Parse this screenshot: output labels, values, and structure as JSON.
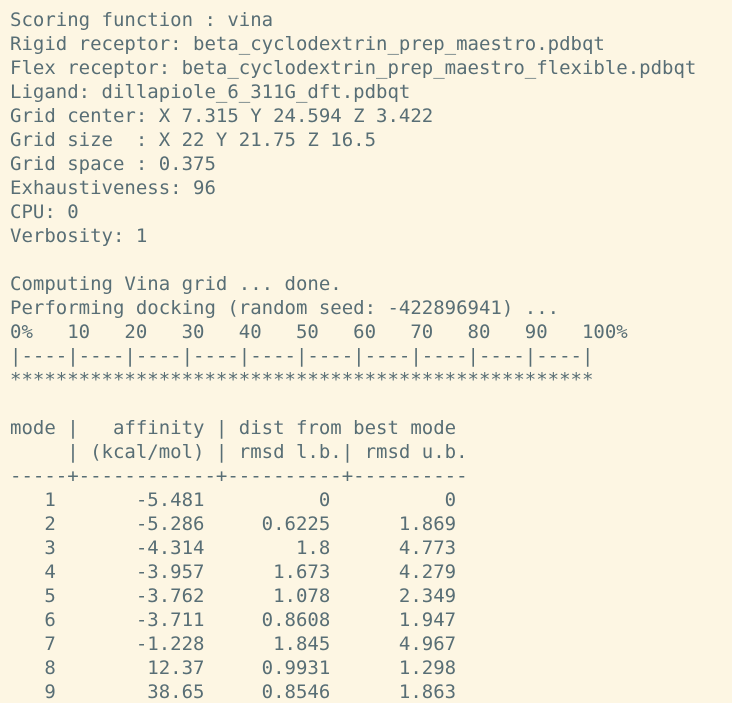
{
  "terminal": {
    "header": [
      "Scoring function : vina",
      "Rigid receptor: beta_cyclodextrin_prep_maestro.pdbqt",
      "Flex receptor: beta_cyclodextrin_prep_maestro_flexible.pdbqt",
      "Ligand: dillapiole_6_311G_dft.pdbqt",
      "Grid center: X 7.315 Y 24.594 Z 3.422",
      "Grid size  : X 22 Y 21.75 Z 16.5",
      "Grid space : 0.375",
      "Exhaustiveness: 96",
      "CPU: 0",
      "Verbosity: 1"
    ],
    "progress": [
      "Computing Vina grid ... done.",
      "Performing docking (random seed: -422896941) ...",
      "0%   10   20   30   40   50   60   70   80   90   100%",
      "|----|----|----|----|----|----|----|----|----|----|",
      "***************************************************"
    ],
    "table_header": [
      "mode |   affinity | dist from best mode",
      "     | (kcal/mol) | rmsd l.b.| rmsd u.b.",
      "-----+------------+----------+----------"
    ],
    "rows": [
      "   1       -5.481          0          0",
      "   2       -5.286     0.6225      1.869",
      "   3       -4.314        1.8      4.773",
      "   4       -3.957      1.673      4.279",
      "   5       -3.762      1.078      2.349",
      "   6       -3.711     0.8608      1.947",
      "   7       -1.228      1.845      4.967",
      "   8        12.37     0.9931      1.298",
      "   9        38.65     0.8546      1.863"
    ]
  }
}
